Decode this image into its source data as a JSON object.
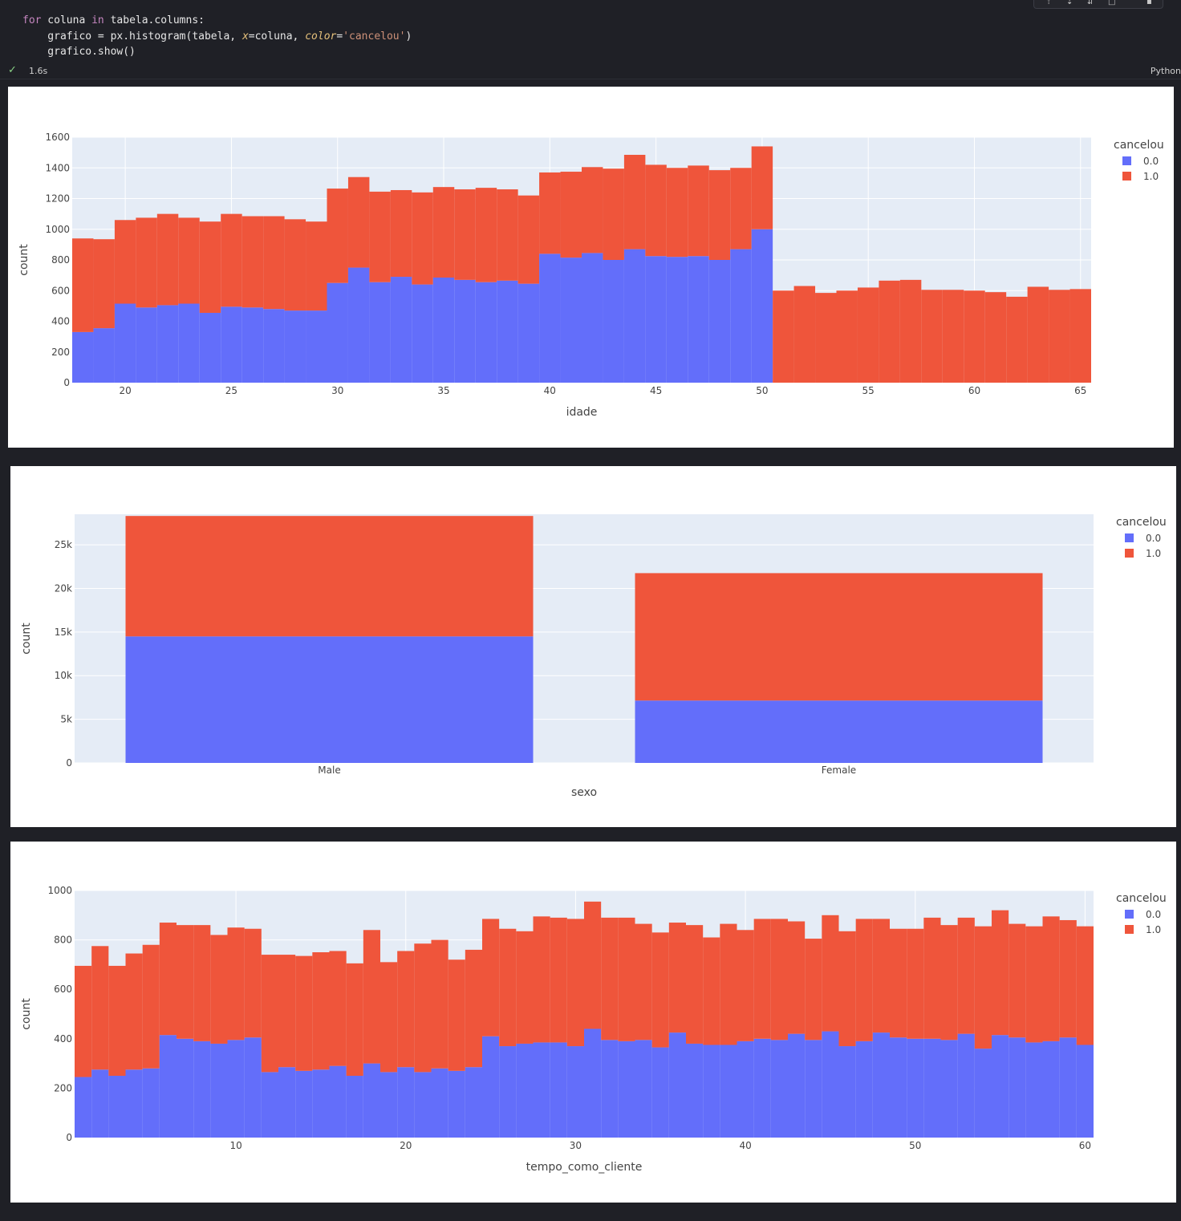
{
  "code": {
    "line1": {
      "kw1": "for",
      "a": " coluna ",
      "kw2": "in",
      "b": " tabela.columns:"
    },
    "line2": {
      "a": "    grafico = px.histogram(tabela, ",
      "p1": "x",
      "b": "=coluna, ",
      "p2": "color",
      "c": "=",
      "s": "'cancelou'",
      "d": ")"
    },
    "line3": "    grafico.show()"
  },
  "status": {
    "duration": "1.6s",
    "kernel": "Python"
  },
  "colors": {
    "class0": "#636efa",
    "class1": "#ef553b",
    "plot_bg": "#e5ecf6",
    "grid": "#ffffff"
  },
  "icons": [
    "check-icon",
    "run-above-icon",
    "run-below-icon",
    "split-icon",
    "delete-icon"
  ],
  "chart_data": [
    {
      "type": "bar",
      "stacked": true,
      "xlabel": "idade",
      "ylabel": "count",
      "legend_title": "cancelou",
      "series_names": [
        "0.0",
        "1.0"
      ],
      "bin_start": 17.5,
      "bin_width": 1,
      "ylim": [
        0,
        1600
      ],
      "yticks": [
        0,
        200,
        400,
        600,
        800,
        1000,
        1200,
        1400,
        1600
      ],
      "xlim": [
        17.5,
        65.5
      ],
      "xticks": [
        20,
        25,
        30,
        35,
        40,
        45,
        50,
        55,
        60,
        65
      ],
      "x": [
        18,
        19,
        20,
        21,
        22,
        23,
        24,
        25,
        26,
        27,
        28,
        29,
        30,
        31,
        32,
        33,
        34,
        35,
        36,
        37,
        38,
        39,
        40,
        41,
        42,
        43,
        44,
        45,
        46,
        47,
        48,
        49,
        50,
        51,
        52,
        53,
        54,
        55,
        56,
        57,
        58,
        59,
        60,
        61,
        62,
        63,
        64,
        65
      ],
      "series": [
        {
          "name": "0.0",
          "values": [
            330,
            355,
            515,
            490,
            505,
            515,
            455,
            495,
            490,
            480,
            470,
            470,
            650,
            750,
            655,
            690,
            640,
            685,
            670,
            655,
            665,
            645,
            840,
            815,
            845,
            800,
            870,
            825,
            820,
            825,
            800,
            870,
            1000,
            0,
            0,
            0,
            0,
            0,
            0,
            0,
            0,
            0,
            0,
            0,
            0,
            0,
            0,
            0
          ]
        },
        {
          "name": "1.0",
          "values": [
            610,
            580,
            545,
            585,
            595,
            560,
            595,
            605,
            595,
            605,
            595,
            580,
            615,
            590,
            590,
            565,
            600,
            590,
            590,
            615,
            595,
            575,
            530,
            560,
            560,
            595,
            615,
            595,
            580,
            590,
            585,
            530,
            540,
            600,
            630,
            585,
            600,
            620,
            665,
            670,
            605,
            605,
            600,
            590,
            560,
            625,
            605,
            610
          ]
        }
      ]
    },
    {
      "type": "bar",
      "stacked": true,
      "xlabel": "sexo",
      "ylabel": "count",
      "legend_title": "cancelou",
      "categories": [
        "Male",
        "Female"
      ],
      "ylim": [
        0,
        28500
      ],
      "yticks": [
        0,
        5000,
        10000,
        15000,
        20000,
        25000
      ],
      "ytick_labels": [
        "0",
        "5k",
        "10k",
        "15k",
        "20k",
        "25k"
      ],
      "series": [
        {
          "name": "0.0",
          "values": [
            14500,
            7150
          ]
        },
        {
          "name": "1.0",
          "values": [
            13800,
            14600
          ]
        }
      ]
    },
    {
      "type": "bar",
      "stacked": true,
      "xlabel": "tempo_como_cliente",
      "ylabel": "count",
      "legend_title": "cancelou",
      "bin_start": 0.5,
      "bin_width": 1,
      "ylim": [
        0,
        1000
      ],
      "yticks": [
        0,
        200,
        400,
        600,
        800,
        1000
      ],
      "xlim": [
        0.5,
        60.5
      ],
      "xticks": [
        10,
        20,
        30,
        40,
        50,
        60
      ],
      "x": [
        1,
        2,
        3,
        4,
        5,
        6,
        7,
        8,
        9,
        10,
        11,
        12,
        13,
        14,
        15,
        16,
        17,
        18,
        19,
        20,
        21,
        22,
        23,
        24,
        25,
        26,
        27,
        28,
        29,
        30,
        31,
        32,
        33,
        34,
        35,
        36,
        37,
        38,
        39,
        40,
        41,
        42,
        43,
        44,
        45,
        46,
        47,
        48,
        49,
        50,
        51,
        52,
        53,
        54,
        55,
        56,
        57,
        58,
        59,
        60
      ],
      "series": [
        {
          "name": "0.0",
          "values": [
            245,
            275,
            250,
            275,
            280,
            415,
            400,
            390,
            380,
            395,
            405,
            265,
            285,
            270,
            275,
            290,
            250,
            300,
            265,
            285,
            265,
            280,
            270,
            285,
            410,
            370,
            380,
            385,
            385,
            370,
            440,
            395,
            390,
            395,
            365,
            425,
            380,
            375,
            375,
            390,
            400,
            395,
            420,
            395,
            430,
            370,
            390,
            425,
            405,
            400,
            400,
            395,
            420,
            360,
            415,
            405,
            385,
            390,
            405,
            375
          ]
        },
        {
          "name": "1.0",
          "values": [
            450,
            500,
            445,
            470,
            500,
            455,
            460,
            470,
            440,
            455,
            440,
            475,
            455,
            465,
            475,
            465,
            455,
            540,
            445,
            470,
            520,
            520,
            450,
            475,
            475,
            475,
            455,
            510,
            505,
            515,
            515,
            495,
            500,
            470,
            465,
            445,
            480,
            435,
            490,
            450,
            485,
            490,
            455,
            410,
            470,
            465,
            495,
            460,
            440,
            445,
            490,
            465,
            470,
            495,
            505,
            460,
            470,
            505,
            475,
            480
          ]
        }
      ]
    }
  ]
}
